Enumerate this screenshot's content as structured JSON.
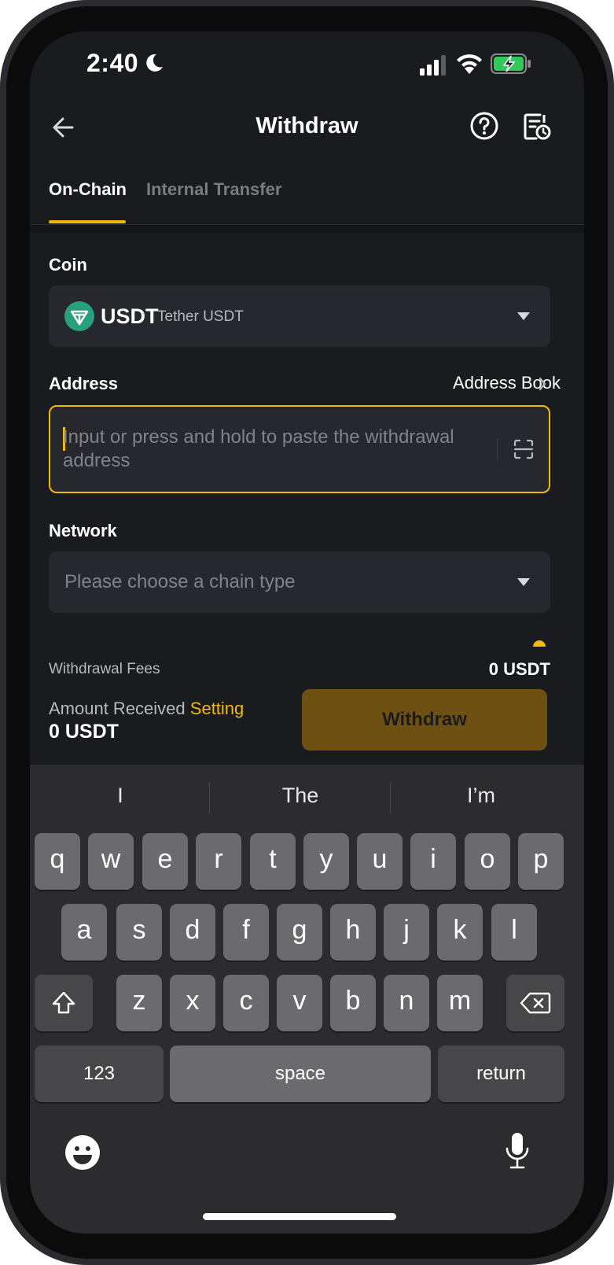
{
  "status_bar": {
    "time": "2:40"
  },
  "header": {
    "title": "Withdraw"
  },
  "tabs": [
    {
      "label": "On-Chain",
      "active": true
    },
    {
      "label": "Internal Transfer",
      "active": false
    }
  ],
  "coin": {
    "label": "Coin",
    "symbol": "USDT",
    "name": "Tether USDT"
  },
  "address": {
    "label": "Address",
    "book_label": "Address Book",
    "placeholder": "Input or press and hold to paste the withdrawal address"
  },
  "network": {
    "label": "Network",
    "placeholder": "Please choose a chain type"
  },
  "summary": {
    "fees_label": "Withdrawal Fees",
    "fees_value": "0 USDT",
    "amount_label": "Amount Received",
    "setting_link": "Setting",
    "amount_value": "0 USDT",
    "withdraw_button": "Withdraw"
  },
  "keyboard": {
    "suggestions": [
      "I",
      "The",
      "I’m"
    ],
    "row1": [
      "q",
      "w",
      "e",
      "r",
      "t",
      "y",
      "u",
      "i",
      "o",
      "p"
    ],
    "row2": [
      "a",
      "s",
      "d",
      "f",
      "g",
      "h",
      "j",
      "k",
      "l"
    ],
    "row3": [
      "z",
      "x",
      "c",
      "v",
      "b",
      "n",
      "m"
    ],
    "numbers_key": "123",
    "space_key": "space",
    "return_key": "return"
  },
  "colors": {
    "accent": "#f0b90b",
    "background": "#1a1b1f",
    "field": "#26282d",
    "usdt_logo": "#26a17b",
    "withdraw_button_disabled": "#6f5013"
  },
  "icons": {
    "back": "arrow-left-icon",
    "help": "question-circle-icon",
    "history": "history-document-icon",
    "scan": "scan-qr-icon",
    "chevron": "chevron-right-icon",
    "dropdown": "caret-down-icon"
  }
}
